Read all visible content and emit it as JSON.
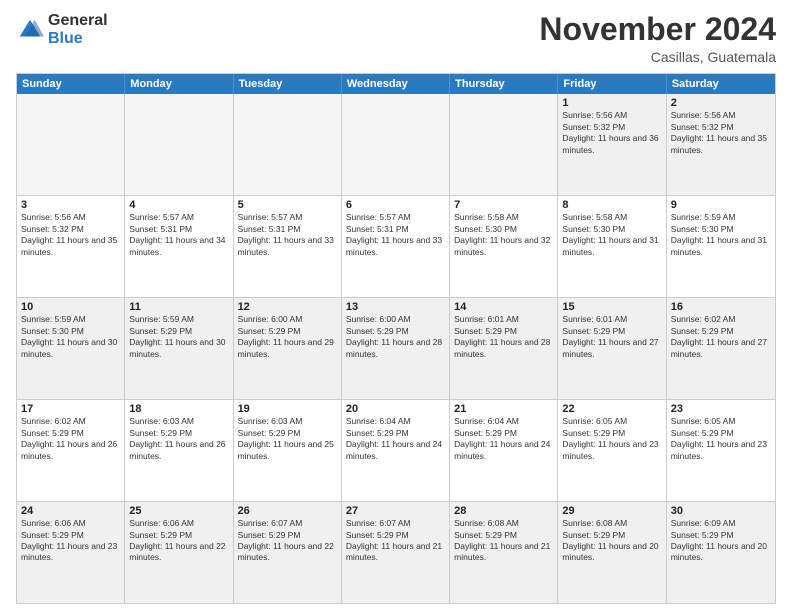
{
  "logo": {
    "general": "General",
    "blue": "Blue"
  },
  "title": "November 2024",
  "location": "Casillas, Guatemala",
  "days_of_week": [
    "Sunday",
    "Monday",
    "Tuesday",
    "Wednesday",
    "Thursday",
    "Friday",
    "Saturday"
  ],
  "weeks": [
    [
      {
        "day": "",
        "empty": true
      },
      {
        "day": "",
        "empty": true
      },
      {
        "day": "",
        "empty": true
      },
      {
        "day": "",
        "empty": true
      },
      {
        "day": "",
        "empty": true
      },
      {
        "day": "1",
        "sunrise": "Sunrise: 5:56 AM",
        "sunset": "Sunset: 5:32 PM",
        "daylight": "Daylight: 11 hours and 36 minutes."
      },
      {
        "day": "2",
        "sunrise": "Sunrise: 5:56 AM",
        "sunset": "Sunset: 5:32 PM",
        "daylight": "Daylight: 11 hours and 35 minutes."
      }
    ],
    [
      {
        "day": "3",
        "sunrise": "Sunrise: 5:56 AM",
        "sunset": "Sunset: 5:32 PM",
        "daylight": "Daylight: 11 hours and 35 minutes."
      },
      {
        "day": "4",
        "sunrise": "Sunrise: 5:57 AM",
        "sunset": "Sunset: 5:31 PM",
        "daylight": "Daylight: 11 hours and 34 minutes."
      },
      {
        "day": "5",
        "sunrise": "Sunrise: 5:57 AM",
        "sunset": "Sunset: 5:31 PM",
        "daylight": "Daylight: 11 hours and 33 minutes."
      },
      {
        "day": "6",
        "sunrise": "Sunrise: 5:57 AM",
        "sunset": "Sunset: 5:31 PM",
        "daylight": "Daylight: 11 hours and 33 minutes."
      },
      {
        "day": "7",
        "sunrise": "Sunrise: 5:58 AM",
        "sunset": "Sunset: 5:30 PM",
        "daylight": "Daylight: 11 hours and 32 minutes."
      },
      {
        "day": "8",
        "sunrise": "Sunrise: 5:58 AM",
        "sunset": "Sunset: 5:30 PM",
        "daylight": "Daylight: 11 hours and 31 minutes."
      },
      {
        "day": "9",
        "sunrise": "Sunrise: 5:59 AM",
        "sunset": "Sunset: 5:30 PM",
        "daylight": "Daylight: 11 hours and 31 minutes."
      }
    ],
    [
      {
        "day": "10",
        "sunrise": "Sunrise: 5:59 AM",
        "sunset": "Sunset: 5:30 PM",
        "daylight": "Daylight: 11 hours and 30 minutes."
      },
      {
        "day": "11",
        "sunrise": "Sunrise: 5:59 AM",
        "sunset": "Sunset: 5:29 PM",
        "daylight": "Daylight: 11 hours and 30 minutes."
      },
      {
        "day": "12",
        "sunrise": "Sunrise: 6:00 AM",
        "sunset": "Sunset: 5:29 PM",
        "daylight": "Daylight: 11 hours and 29 minutes."
      },
      {
        "day": "13",
        "sunrise": "Sunrise: 6:00 AM",
        "sunset": "Sunset: 5:29 PM",
        "daylight": "Daylight: 11 hours and 28 minutes."
      },
      {
        "day": "14",
        "sunrise": "Sunrise: 6:01 AM",
        "sunset": "Sunset: 5:29 PM",
        "daylight": "Daylight: 11 hours and 28 minutes."
      },
      {
        "day": "15",
        "sunrise": "Sunrise: 6:01 AM",
        "sunset": "Sunset: 5:29 PM",
        "daylight": "Daylight: 11 hours and 27 minutes."
      },
      {
        "day": "16",
        "sunrise": "Sunrise: 6:02 AM",
        "sunset": "Sunset: 5:29 PM",
        "daylight": "Daylight: 11 hours and 27 minutes."
      }
    ],
    [
      {
        "day": "17",
        "sunrise": "Sunrise: 6:02 AM",
        "sunset": "Sunset: 5:29 PM",
        "daylight": "Daylight: 11 hours and 26 minutes."
      },
      {
        "day": "18",
        "sunrise": "Sunrise: 6:03 AM",
        "sunset": "Sunset: 5:29 PM",
        "daylight": "Daylight: 11 hours and 26 minutes."
      },
      {
        "day": "19",
        "sunrise": "Sunrise: 6:03 AM",
        "sunset": "Sunset: 5:29 PM",
        "daylight": "Daylight: 11 hours and 25 minutes."
      },
      {
        "day": "20",
        "sunrise": "Sunrise: 6:04 AM",
        "sunset": "Sunset: 5:29 PM",
        "daylight": "Daylight: 11 hours and 24 minutes."
      },
      {
        "day": "21",
        "sunrise": "Sunrise: 6:04 AM",
        "sunset": "Sunset: 5:29 PM",
        "daylight": "Daylight: 11 hours and 24 minutes."
      },
      {
        "day": "22",
        "sunrise": "Sunrise: 6:05 AM",
        "sunset": "Sunset: 5:29 PM",
        "daylight": "Daylight: 11 hours and 23 minutes."
      },
      {
        "day": "23",
        "sunrise": "Sunrise: 6:05 AM",
        "sunset": "Sunset: 5:29 PM",
        "daylight": "Daylight: 11 hours and 23 minutes."
      }
    ],
    [
      {
        "day": "24",
        "sunrise": "Sunrise: 6:06 AM",
        "sunset": "Sunset: 5:29 PM",
        "daylight": "Daylight: 11 hours and 23 minutes."
      },
      {
        "day": "25",
        "sunrise": "Sunrise: 6:06 AM",
        "sunset": "Sunset: 5:29 PM",
        "daylight": "Daylight: 11 hours and 22 minutes."
      },
      {
        "day": "26",
        "sunrise": "Sunrise: 6:07 AM",
        "sunset": "Sunset: 5:29 PM",
        "daylight": "Daylight: 11 hours and 22 minutes."
      },
      {
        "day": "27",
        "sunrise": "Sunrise: 6:07 AM",
        "sunset": "Sunset: 5:29 PM",
        "daylight": "Daylight: 11 hours and 21 minutes."
      },
      {
        "day": "28",
        "sunrise": "Sunrise: 6:08 AM",
        "sunset": "Sunset: 5:29 PM",
        "daylight": "Daylight: 11 hours and 21 minutes."
      },
      {
        "day": "29",
        "sunrise": "Sunrise: 6:08 AM",
        "sunset": "Sunset: 5:29 PM",
        "daylight": "Daylight: 11 hours and 20 minutes."
      },
      {
        "day": "30",
        "sunrise": "Sunrise: 6:09 AM",
        "sunset": "Sunset: 5:29 PM",
        "daylight": "Daylight: 11 hours and 20 minutes."
      }
    ]
  ]
}
